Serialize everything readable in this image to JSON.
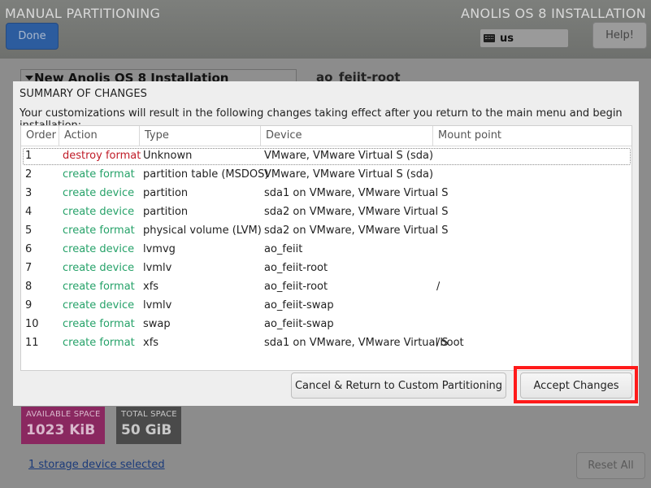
{
  "background": {
    "title": "MANUAL PARTITIONING",
    "product": "ANOLIS OS 8 INSTALLATION",
    "done_label": "Done",
    "keyboard_layout": "us",
    "help_label": "Help!",
    "tree_header": "New Anolis OS 8 Installation",
    "detail_title": "ao_feiit-root",
    "available_space": {
      "label": "AVAILABLE SPACE",
      "value": "1023 KiB"
    },
    "total_space": {
      "label": "TOTAL SPACE",
      "value": "50 GiB"
    },
    "storage_link": "1 storage device selected",
    "reset_label": "Reset All"
  },
  "dialog": {
    "title": "SUMMARY OF CHANGES",
    "description": "Your customizations will result in the following changes taking effect after you return to the main menu and begin installation:",
    "columns": [
      "Order",
      "Action",
      "Type",
      "Device",
      "Mount point"
    ],
    "rows": [
      {
        "order": "1",
        "action": "destroy format",
        "action_kind": "destroy",
        "type": "Unknown",
        "device": "VMware, VMware Virtual S (sda)",
        "mount": ""
      },
      {
        "order": "2",
        "action": "create format",
        "action_kind": "create",
        "type": "partition table (MSDOS)",
        "device": "VMware, VMware Virtual S (sda)",
        "mount": ""
      },
      {
        "order": "3",
        "action": "create device",
        "action_kind": "create",
        "type": "partition",
        "device": "sda1 on VMware, VMware Virtual S",
        "mount": ""
      },
      {
        "order": "4",
        "action": "create device",
        "action_kind": "create",
        "type": "partition",
        "device": "sda2 on VMware, VMware Virtual S",
        "mount": ""
      },
      {
        "order": "5",
        "action": "create format",
        "action_kind": "create",
        "type": "physical volume (LVM)",
        "device": "sda2 on VMware, VMware Virtual S",
        "mount": ""
      },
      {
        "order": "6",
        "action": "create device",
        "action_kind": "create",
        "type": "lvmvg",
        "device": "ao_feiit",
        "mount": ""
      },
      {
        "order": "7",
        "action": "create device",
        "action_kind": "create",
        "type": "lvmlv",
        "device": "ao_feiit-root",
        "mount": ""
      },
      {
        "order": "8",
        "action": "create format",
        "action_kind": "create",
        "type": "xfs",
        "device": "ao_feiit-root",
        "mount": "/"
      },
      {
        "order": "9",
        "action": "create device",
        "action_kind": "create",
        "type": "lvmlv",
        "device": "ao_feiit-swap",
        "mount": ""
      },
      {
        "order": "10",
        "action": "create format",
        "action_kind": "create",
        "type": "swap",
        "device": "ao_feiit-swap",
        "mount": ""
      },
      {
        "order": "11",
        "action": "create format",
        "action_kind": "create",
        "type": "xfs",
        "device": "sda1 on VMware, VMware Virtual S",
        "mount": "/boot"
      }
    ],
    "selected_row": 0,
    "cancel_label": "Cancel & Return to Custom Partitioning",
    "accept_label": "Accept Changes"
  },
  "colors": {
    "destroy_action": "#c01c28",
    "create_action": "#26a269",
    "highlight_box": "#ff1a1a",
    "available_space_bg": "#8a2860"
  }
}
